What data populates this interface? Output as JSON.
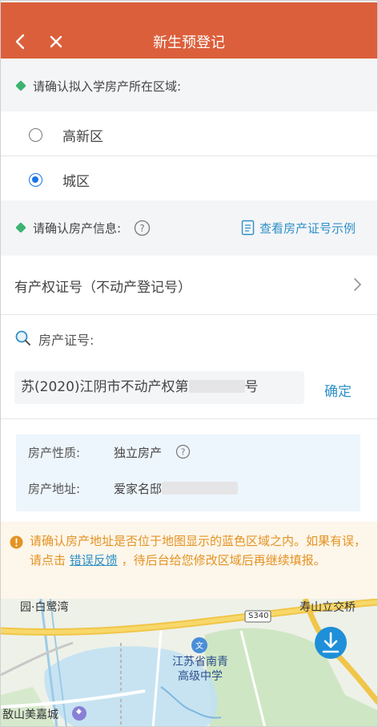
{
  "header": {
    "title": "新生预登记"
  },
  "area_section": {
    "label": "请确认拟入学房产所在区域:",
    "options": [
      {
        "label": "高新区",
        "selected": false
      },
      {
        "label": "城区",
        "selected": true
      }
    ]
  },
  "property_section": {
    "label": "请确认房产信息:",
    "example_link": "查看房产证号示例"
  },
  "cert_type": {
    "label": "有产权证号（不动产登记号）"
  },
  "cert_no": {
    "label": "房产证号:",
    "value_prefix": "苏(2020)江阴市不动产权第",
    "value_suffix": "号",
    "confirm_label": "确定"
  },
  "property_info": {
    "nature_label": "房产性质:",
    "nature_value": "独立房产",
    "address_label": "房产地址:",
    "address_value": "爱家名邸"
  },
  "warning": {
    "text_before": "请确认房产地址是否位于地图显示的蓝色区域之内。如果有误，请点击",
    "link": "错误反馈",
    "text_after": "，待后台给您修改区域后再继续填报。"
  },
  "map": {
    "labels": {
      "top_left": "园·白鹭湾",
      "top_right": "寿山立交桥",
      "road": "S340",
      "school": "江苏省南青高级中学",
      "bottom_left": "敔山美嘉城"
    }
  },
  "colors": {
    "header_bg": "#dc5f3b",
    "accent_blue": "#2f90c8",
    "radio_blue": "#1a73e8",
    "dot_green": "#3cb371",
    "warning_orange": "#e39323"
  }
}
